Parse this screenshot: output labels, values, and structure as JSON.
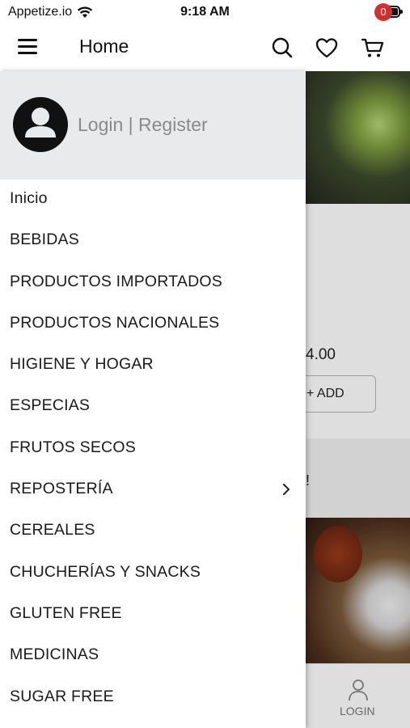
{
  "status": {
    "carrier": "Appetize.io",
    "time": "9:18 AM"
  },
  "app_bar": {
    "title": "Home",
    "cart_count": "0"
  },
  "drawer": {
    "login_label": "Login | Register",
    "items": [
      {
        "label": "Inicio"
      },
      {
        "label": "BEBIDAS"
      },
      {
        "label": "PRODUCTOS IMPORTADOS"
      },
      {
        "label": "PRODUCTOS NACIONALES"
      },
      {
        "label": "HIGIENE Y HOGAR"
      },
      {
        "label": "ESPECIAS"
      },
      {
        "label": "FRUTOS SECOS"
      },
      {
        "label": "REPOSTERÍA",
        "has_submenu": true
      },
      {
        "label": "CEREALES"
      },
      {
        "label": "CHUCHERÍAS Y SNACKS"
      },
      {
        "label": "GLUTEN FREE"
      },
      {
        "label": "MEDICINAS"
      },
      {
        "label": "SUGAR FREE"
      }
    ]
  },
  "background": {
    "price_fragment": "4.00",
    "add_label": "+ ADD",
    "text_fragment": "!",
    "nav_label": "LOGIN"
  },
  "colors": {
    "badge": "#d32f2f",
    "drawer_header": "#e9eaec",
    "login_text": "#8a8a8a"
  }
}
